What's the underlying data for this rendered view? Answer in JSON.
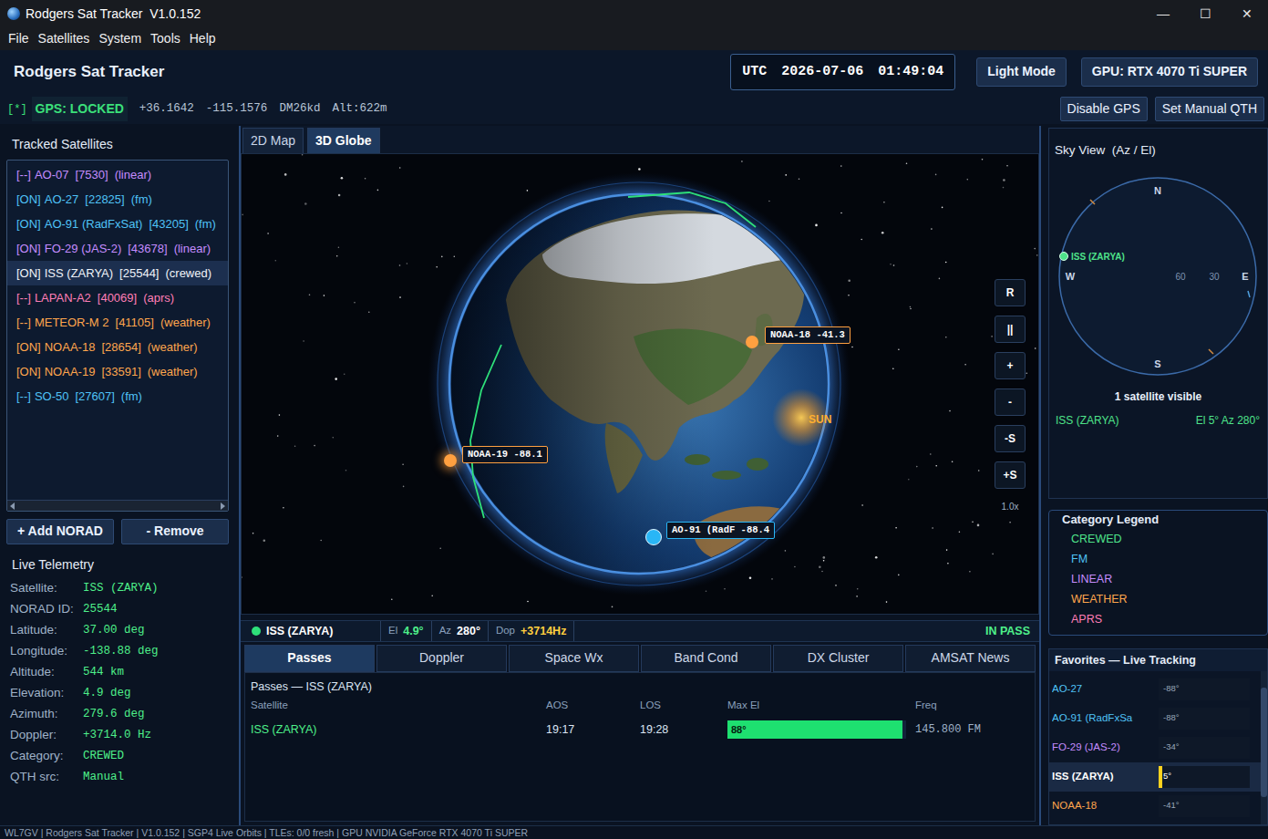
{
  "window": {
    "title": "Rodgers Sat Tracker  V1.0.152",
    "controls": [
      "—",
      "☐",
      "✕"
    ]
  },
  "menu": [
    "File",
    "Satellites",
    "System",
    "Tools",
    "Help"
  ],
  "header": {
    "app_name": "Rodgers Sat Tracker",
    "utc_label": "UTC",
    "date": "2026-07-06",
    "time": "01:49:04",
    "theme_button": "Light Mode",
    "gpu_button": "GPU: RTX 4070 Ti SUPER"
  },
  "gps": {
    "indicator": "[*]",
    "status": "GPS: LOCKED",
    "lat": "+36.1642",
    "lon": "-115.1576",
    "grid": "DM26kd",
    "alt": "Alt:622m",
    "buttons": [
      "Disable GPS",
      "Set Manual QTH"
    ]
  },
  "tracked": {
    "title": "Tracked Satellites",
    "items": [
      {
        "state": "[--]",
        "name": "AO-07",
        "norad": "[7530]",
        "category": "(linear)",
        "color": "#c58cff",
        "selected": false
      },
      {
        "state": "[ON]",
        "name": "AO-27",
        "norad": "[22825]",
        "category": "(fm)",
        "color": "#4fc3f7",
        "selected": false
      },
      {
        "state": "[ON]",
        "name": "AO-91 (RadFxSat)",
        "norad": "[43205]",
        "category": "(fm)",
        "color": "#4fc3f7",
        "selected": false
      },
      {
        "state": "[ON]",
        "name": "FO-29 (JAS-2)",
        "norad": "[43678]",
        "category": "(linear)",
        "color": "#c58cff",
        "selected": false
      },
      {
        "state": "[ON]",
        "name": "ISS (ZARYA)",
        "norad": "[25544]",
        "category": "(crewed)",
        "color": "#f0f4fa",
        "selected": true
      },
      {
        "state": "[--]",
        "name": "LAPAN-A2",
        "norad": "[40069]",
        "category": "(aprs)",
        "color": "#ff7eb6",
        "selected": false
      },
      {
        "state": "[--]",
        "name": "METEOR-M 2",
        "norad": "[41105]",
        "category": "(weather)",
        "color": "#ffa64d",
        "selected": false
      },
      {
        "state": "[ON]",
        "name": "NOAA-18",
        "norad": "[28654]",
        "category": "(weather)",
        "color": "#ffa64d",
        "selected": false
      },
      {
        "state": "[ON]",
        "name": "NOAA-19",
        "norad": "[33591]",
        "category": "(weather)",
        "color": "#ffa64d",
        "selected": false
      },
      {
        "state": "[--]",
        "name": "SO-50",
        "norad": "[27607]",
        "category": "(fm)",
        "color": "#4fc3f7",
        "selected": false
      }
    ]
  },
  "list_buttons": [
    "+ Add NORAD",
    "- Remove"
  ],
  "telemetry": {
    "title": "Live Telemetry",
    "rows": [
      {
        "label": "Satellite:",
        "value": "ISS (ZARYA)"
      },
      {
        "label": "NORAD ID:",
        "value": "25544"
      },
      {
        "label": "Latitude:",
        "value": "37.00 deg"
      },
      {
        "label": "Longitude:",
        "value": "-138.88 deg"
      },
      {
        "label": "Altitude:",
        "value": "544 km"
      },
      {
        "label": "Elevation:",
        "value": "4.9 deg"
      },
      {
        "label": "Azimuth:",
        "value": "279.6 deg"
      },
      {
        "label": "Doppler:",
        "value": "+3714.0 Hz"
      },
      {
        "label": "Category:",
        "value": "CREWED"
      },
      {
        "label": "QTH src:",
        "value": "Manual"
      }
    ]
  },
  "view_tabs": [
    {
      "label": "2D Map",
      "selected": false
    },
    {
      "label": "3D Globe",
      "selected": true
    }
  ],
  "globe": {
    "markers": [
      {
        "label": "NOAA-18 -41.3",
        "color": "#ffa040"
      },
      {
        "label": "NOAA-19 -88.1",
        "color": "#ffa040"
      },
      {
        "label": "AO-91 (RadF -88.4",
        "color": "#29b6f6"
      }
    ],
    "sun": "SUN",
    "controls": [
      "R",
      "||",
      "+",
      "-",
      "-S",
      "+S"
    ],
    "speed": "1.0x"
  },
  "pass_strip": {
    "name": "ISS (ZARYA)",
    "el_label": "El",
    "el": "4.9°",
    "az_label": "Az",
    "az": "280°",
    "dop_label": "Dop",
    "dop": "+3714Hz",
    "status": "IN PASS"
  },
  "info_tabs": [
    {
      "label": "Passes",
      "selected": true
    },
    {
      "label": "Doppler",
      "selected": false
    },
    {
      "label": "Space Wx",
      "selected": false
    },
    {
      "label": "Band Cond",
      "selected": false
    },
    {
      "label": "DX Cluster",
      "selected": false
    },
    {
      "label": "AMSAT News",
      "selected": false
    }
  ],
  "passes": {
    "title": "Passes — ISS (ZARYA)",
    "columns": [
      "Satellite",
      "AOS",
      "LOS",
      "Max El",
      "Freq"
    ],
    "rows": [
      {
        "satellite": "ISS (ZARYA)",
        "aos": "19:17",
        "los": "19:28",
        "max_el": "88°",
        "level": 0.98,
        "freq": "145.800 FM"
      }
    ]
  },
  "sky_view": {
    "title": "Sky View  (Az / El)",
    "compass": [
      "N",
      "E",
      "S",
      "W"
    ],
    "rings": [
      "60",
      "30"
    ],
    "sats": [
      {
        "name": "ISS (ZARYA)"
      }
    ],
    "visible_count": "1 satellite visible",
    "visible": [
      {
        "name": "ISS (ZARYA)",
        "reading": "El 5°  Az 280°"
      }
    ]
  },
  "legend": {
    "title": "Category Legend",
    "items": [
      {
        "label": "CREWED",
        "color": "#4ee38a"
      },
      {
        "label": "FM",
        "color": "#4fc3f7"
      },
      {
        "label": "LINEAR",
        "color": "#c58cff"
      },
      {
        "label": "WEATHER",
        "color": "#ffa64d"
      },
      {
        "label": "APRS",
        "color": "#ff7eb6"
      }
    ]
  },
  "favorites": {
    "title": "Favorites — Live Tracking",
    "items": [
      {
        "name": "AO-27",
        "reading": "-88°",
        "level": 0,
        "selected": false,
        "color": "#4fc3f7"
      },
      {
        "name": "AO-91 (RadFxSa",
        "reading": "-88°",
        "level": 0,
        "selected": false,
        "color": "#4fc3f7"
      },
      {
        "name": "FO-29 (JAS-2)",
        "reading": "-34°",
        "level": 0,
        "selected": false,
        "color": "#c58cff"
      },
      {
        "name": "ISS (ZARYA)",
        "reading": "5°",
        "level": 0.04,
        "selected": true,
        "color": "#ffffff"
      },
      {
        "name": "NOAA-18",
        "reading": "-41°",
        "level": 0,
        "selected": false,
        "color": "#ffa64d"
      }
    ]
  },
  "status_bar": "WL7GV | Rodgers Sat Tracker | V1.0.152 | SGP4 Live Orbits | TLEs: 0/0 fresh | GPU NVIDIA GeForce RTX 4070 Ti SUPER"
}
